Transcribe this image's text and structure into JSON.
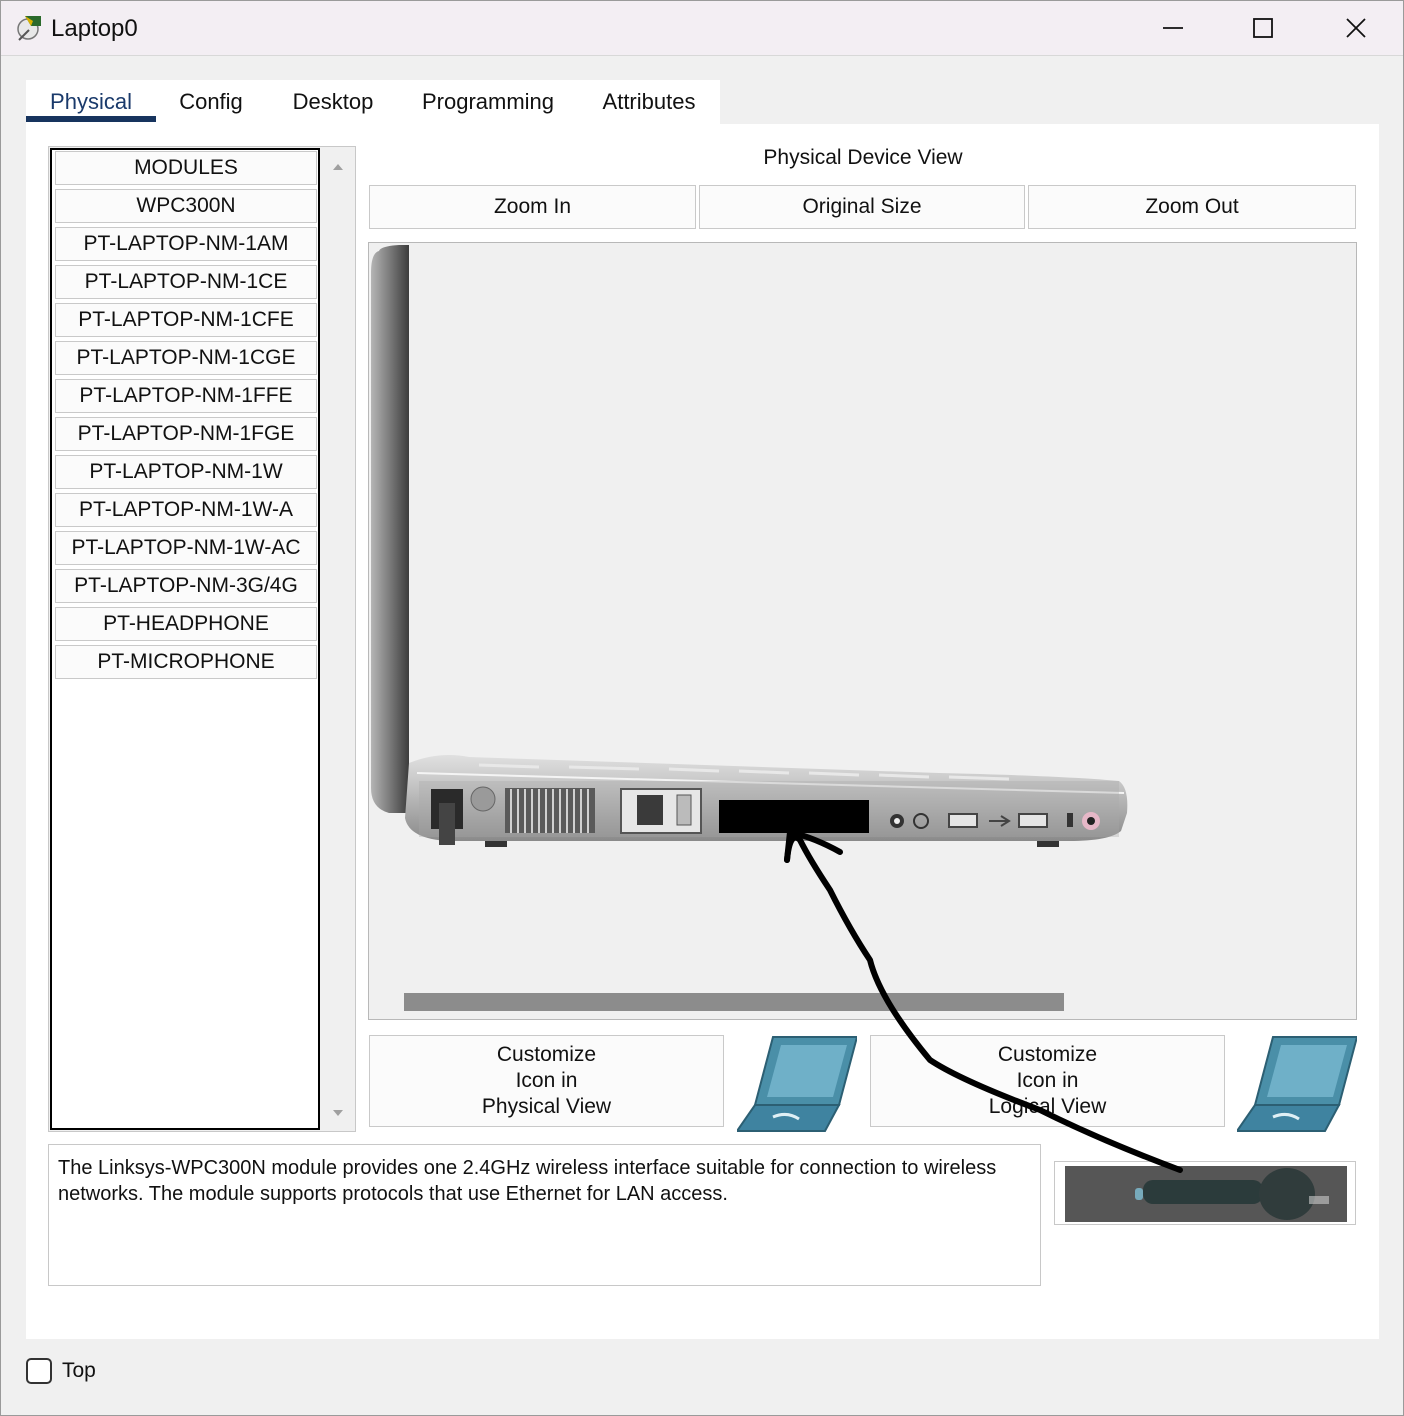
{
  "window": {
    "title": "Laptop0",
    "controls": [
      "minimize",
      "maximize",
      "close"
    ]
  },
  "tabs": [
    {
      "label": "Physical",
      "active": true
    },
    {
      "label": "Config",
      "active": false
    },
    {
      "label": "Desktop",
      "active": false
    },
    {
      "label": "Programming",
      "active": false
    },
    {
      "label": "Attributes",
      "active": false
    }
  ],
  "modules": {
    "items": [
      "MODULES",
      "WPC300N",
      "PT-LAPTOP-NM-1AM",
      "PT-LAPTOP-NM-1CE",
      "PT-LAPTOP-NM-1CFE",
      "PT-LAPTOP-NM-1CGE",
      "PT-LAPTOP-NM-1FFE",
      "PT-LAPTOP-NM-1FGE",
      "PT-LAPTOP-NM-1W",
      "PT-LAPTOP-NM-1W-A",
      "PT-LAPTOP-NM-1W-AC",
      "PT-LAPTOP-NM-3G/4G",
      "PT-HEADPHONE",
      "PT-MICROPHONE"
    ]
  },
  "device_view": {
    "title": "Physical Device View",
    "zoom_in": "Zoom In",
    "original_size": "Original Size",
    "zoom_out": "Zoom Out"
  },
  "customize": {
    "physical": [
      "Customize",
      "Icon in",
      "Physical View"
    ],
    "logical": [
      "Customize",
      "Icon in",
      "Logical View"
    ]
  },
  "description": "The Linksys-WPC300N module provides one 2.4GHz wireless interface suitable for connection to wireless networks. The module supports protocols that use Ethernet for LAN access.",
  "footer": {
    "top_label": "Top",
    "top_checked": false
  },
  "colors": {
    "accent": "#17345e",
    "laptop_icon": "#4a8fa8"
  },
  "icons": [
    "packet-tracer-app-icon",
    "minimize-icon",
    "maximize-icon",
    "close-icon",
    "laptop-icon",
    "scroll-up-arrow-icon",
    "scroll-down-arrow-icon"
  ]
}
